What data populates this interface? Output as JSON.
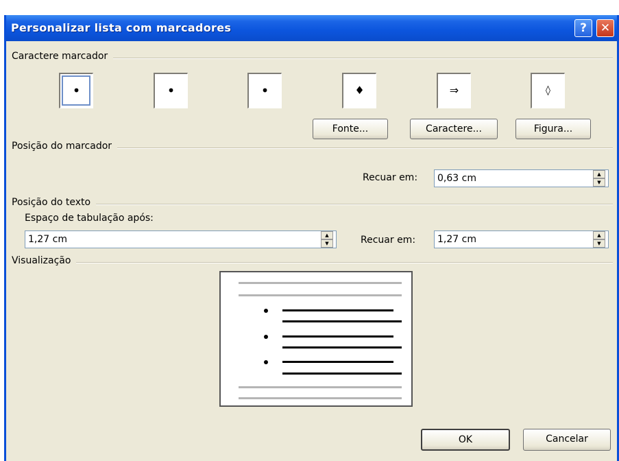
{
  "window": {
    "title": "Personalizar lista com marcadores",
    "help_label": "?",
    "close_label": "✕"
  },
  "bullet_char": {
    "group_label": "Caractere marcador",
    "items": [
      {
        "glyph": "•",
        "selected": true
      },
      {
        "glyph": "•",
        "selected": false
      },
      {
        "glyph": "•",
        "selected": false
      },
      {
        "glyph": "♦",
        "selected": false
      },
      {
        "glyph": "⇒",
        "selected": false
      },
      {
        "glyph": "◊",
        "selected": false
      }
    ],
    "font_button": "Fonte...",
    "character_button": "Caractere...",
    "picture_button": "Figura..."
  },
  "bullet_position": {
    "group_label": "Posição do marcador",
    "indent_label": "Recuar em:",
    "indent_value": "0,63 cm"
  },
  "text_position": {
    "group_label": "Posição do texto",
    "tab_label": "Espaço de tabulação após:",
    "tab_value": "1,27 cm",
    "indent_label": "Recuar em:",
    "indent_value": "1,27 cm"
  },
  "preview": {
    "group_label": "Visualização"
  },
  "footer": {
    "ok_label": "OK",
    "cancel_label": "Cancelar"
  }
}
